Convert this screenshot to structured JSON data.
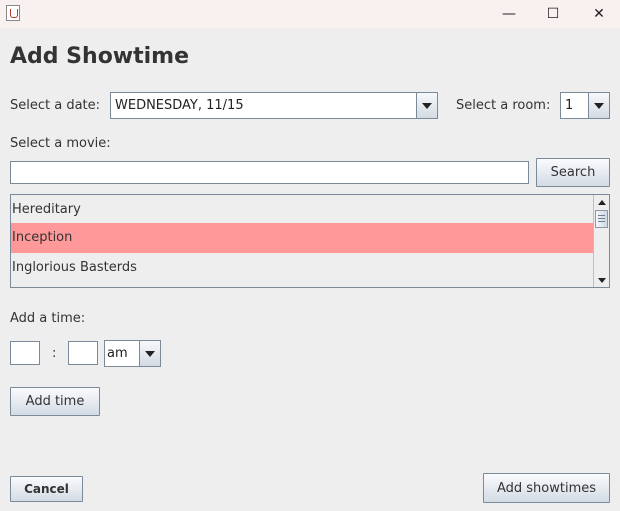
{
  "window": {
    "minimize_glyph": "—",
    "maximize_glyph": "☐",
    "close_glyph": "✕"
  },
  "heading": "Add Showtime",
  "date": {
    "label": "Select a date:",
    "selected": "WEDNESDAY, 11/15"
  },
  "room": {
    "label": "Select a room:",
    "selected": "1"
  },
  "movie": {
    "label": "Select a movie:",
    "search_value": "",
    "search_button": "Search",
    "items": [
      {
        "label": "Hereditary",
        "selected": false
      },
      {
        "label": "Inception",
        "selected": true
      },
      {
        "label": "Inglorious Basterds",
        "selected": false
      }
    ]
  },
  "time": {
    "label": "Add a time:",
    "hour_value": "",
    "separator": ":",
    "minute_value": "",
    "ampm_selected": "am",
    "add_button": "Add time"
  },
  "footer": {
    "cancel_label": "Cancel",
    "add_showtimes_label": "Add showtimes"
  },
  "colors": {
    "selection": "#ff9999",
    "background": "#eeeeee"
  },
  "icons": {
    "app": "java-cup-icon",
    "dropdown": "chevron-down-icon",
    "scroll_up": "arrow-up-icon",
    "scroll_down": "arrow-down-icon"
  }
}
